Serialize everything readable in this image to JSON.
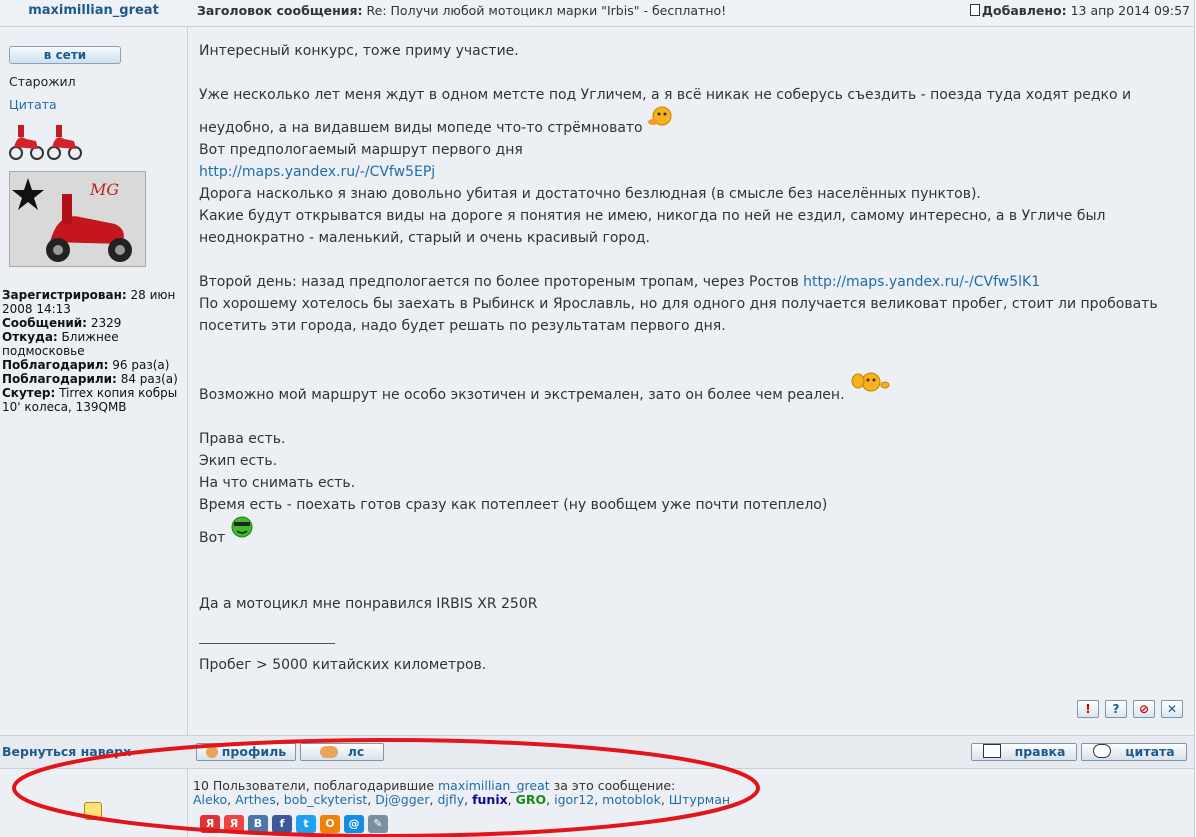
{
  "post": {
    "author": "maximillian_great",
    "subject_label": "Заголовок сообщения:",
    "subject_text": "Re: Получи любой мотоцикл марки \"Irbis\" - бесплатно!",
    "added_label": "Добавлено:",
    "added_date": "13 апр 2014 09:57"
  },
  "sidebar": {
    "online_button": "в сети",
    "rank": "Старожил",
    "quote_link": "Цитата",
    "avatar_text": "MG",
    "registered_label": "Зарегистрирован:",
    "registered_value": "28 июн 2008 14:13",
    "posts_label": "Сообщений:",
    "posts_value": "2329",
    "from_label": "Откуда:",
    "from_value": "Ближнее подмосковье",
    "thanked_label": "Поблагодарил:",
    "thanked_value": "96 раз(а)",
    "thanked_by_label": "Поблагодарили:",
    "thanked_by_value": "84 раз(а)",
    "scooter_label": "Скутер:",
    "scooter_value": "Tirrex копия кобры 10' колеса, 139QMB",
    "back_to_top": "Вернуться наверх"
  },
  "message": {
    "p1": "Интересный конкурс, тоже приму участие.",
    "p2a": "Уже несколько лет меня ждут в одном метсте под Угличем, а я всё никак не соберусь съездить - поезда туда ходят редко и неудобно, а на видавшем виды мопеде что-то стрёмновато",
    "p2b": "Вот предпологаемый маршрут первого дня",
    "link1": "http://maps.yandex.ru/-/CVfw5EPj",
    "p2c": "Дорога насколько я знаю довольно убитая и достаточно безлюдная (в смысле без населённых пунктов).",
    "p2d": "Какие будут открыватся виды на дороге я понятия не имею, никогда по ней не ездил, самому интересно, а в Угличе был неоднократно - маленький, старый и очень красивый город.",
    "p3a": "Второй день: назад предпологается по более протореным тропам, через Ростов",
    "link2": "http://maps.yandex.ru/-/CVfw5lK1",
    "p3b": "По хорошему хотелось бы заехать в Рыбинск и Ярославль, но для одного дня получается великоват пробег, стоит ли пробовать посетить эти города, надо будет решать по результатам первого дня.",
    "p4": "Возможно мой маршрут не особо экзотичен и экстремален, зато он более чем реален.",
    "p5a": "Права есть.",
    "p5b": "Экип есть.",
    "p5c": "На что снимать есть.",
    "p5d": "Время есть - поехать готов сразу как потеплеет (ну вообщем уже почти потеплело)",
    "p5e": "Вот",
    "p6": "Да а мотоцикл мне понравился IRBIS XR 250R",
    "signature": "Пробег > 5000 китайских километров."
  },
  "actions": {
    "profile": "профиль",
    "pm": "лс",
    "edit": "правка",
    "quote": "цитата",
    "report": "!",
    "help": "?",
    "warn": "⊘",
    "delete": "✕"
  },
  "thanks": {
    "prefix": "10 Пользователи, поблагодарившие",
    "author": "maximillian_great",
    "suffix": "за это сообщение:",
    "users": [
      "Aleko",
      "Arthes",
      "bob_ckyterist",
      "Dj@gger",
      "djfly",
      "funix",
      "GRO",
      "igor12",
      "motoblok",
      "Штурман"
    ]
  },
  "share_icons": [
    "Я",
    "В",
    "f",
    "t",
    "О",
    "@",
    "✎"
  ],
  "accent_colors": {
    "link": "#1f6ea8",
    "annotation_ellipse": "#e3151a",
    "gro": "#1a8a1a",
    "funix": "#0b0b8a"
  }
}
